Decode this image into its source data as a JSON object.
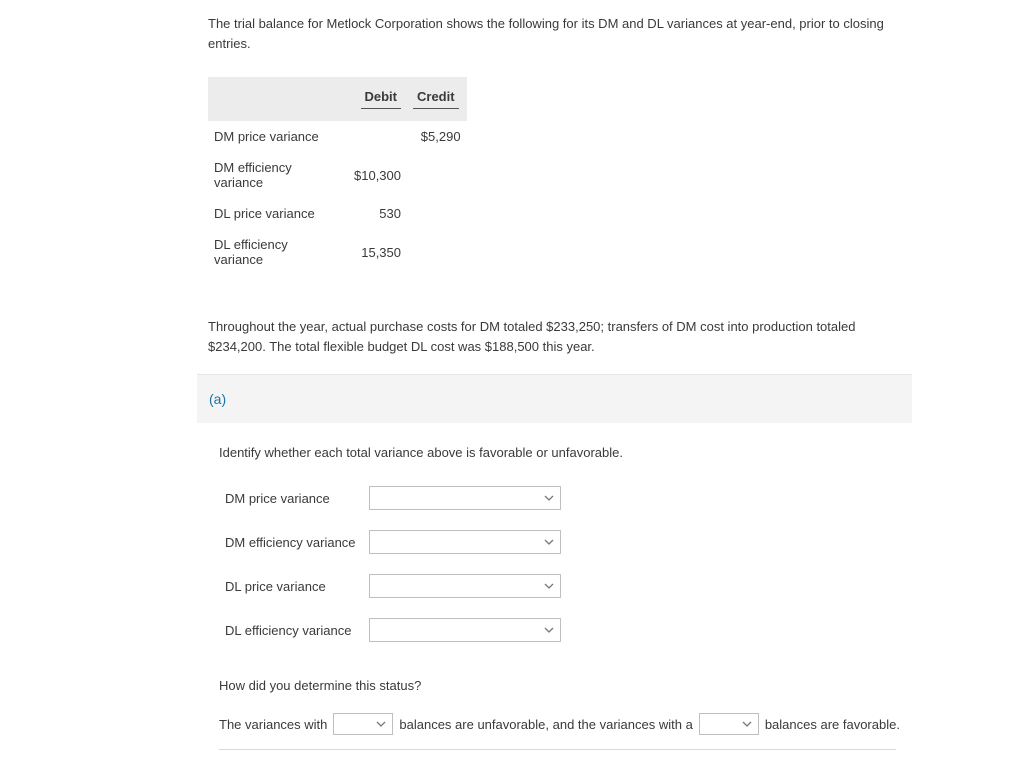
{
  "intro": "The trial balance for Metlock Corporation shows the following for its DM and DL variances at year-end, prior to closing entries.",
  "table": {
    "headers": {
      "debit": "Debit",
      "credit": "Credit"
    },
    "rows": [
      {
        "label": "DM price variance",
        "debit": "",
        "credit": "$5,290"
      },
      {
        "label": "DM efficiency variance",
        "debit": "$10,300",
        "credit": ""
      },
      {
        "label": "DL price variance",
        "debit": "530",
        "credit": ""
      },
      {
        "label": "DL efficiency variance",
        "debit": "15,350",
        "credit": ""
      }
    ]
  },
  "para2": "Throughout the year, actual purchase costs for DM totaled $233,250; transfers of DM cost into production totaled $234,200. The total flexible budget DL cost was $188,500 this year.",
  "section": {
    "label": "(a)",
    "instruction": "Identify whether each total variance above is favorable or unfavorable.",
    "items": [
      "DM price variance",
      "DM efficiency variance",
      "DL price variance",
      "DL efficiency variance"
    ],
    "question": "How did you determine this status?",
    "sentence": {
      "p1": "The variances with",
      "p2": "balances are unfavorable, and the variances with a",
      "p3": "balances are favorable."
    }
  }
}
